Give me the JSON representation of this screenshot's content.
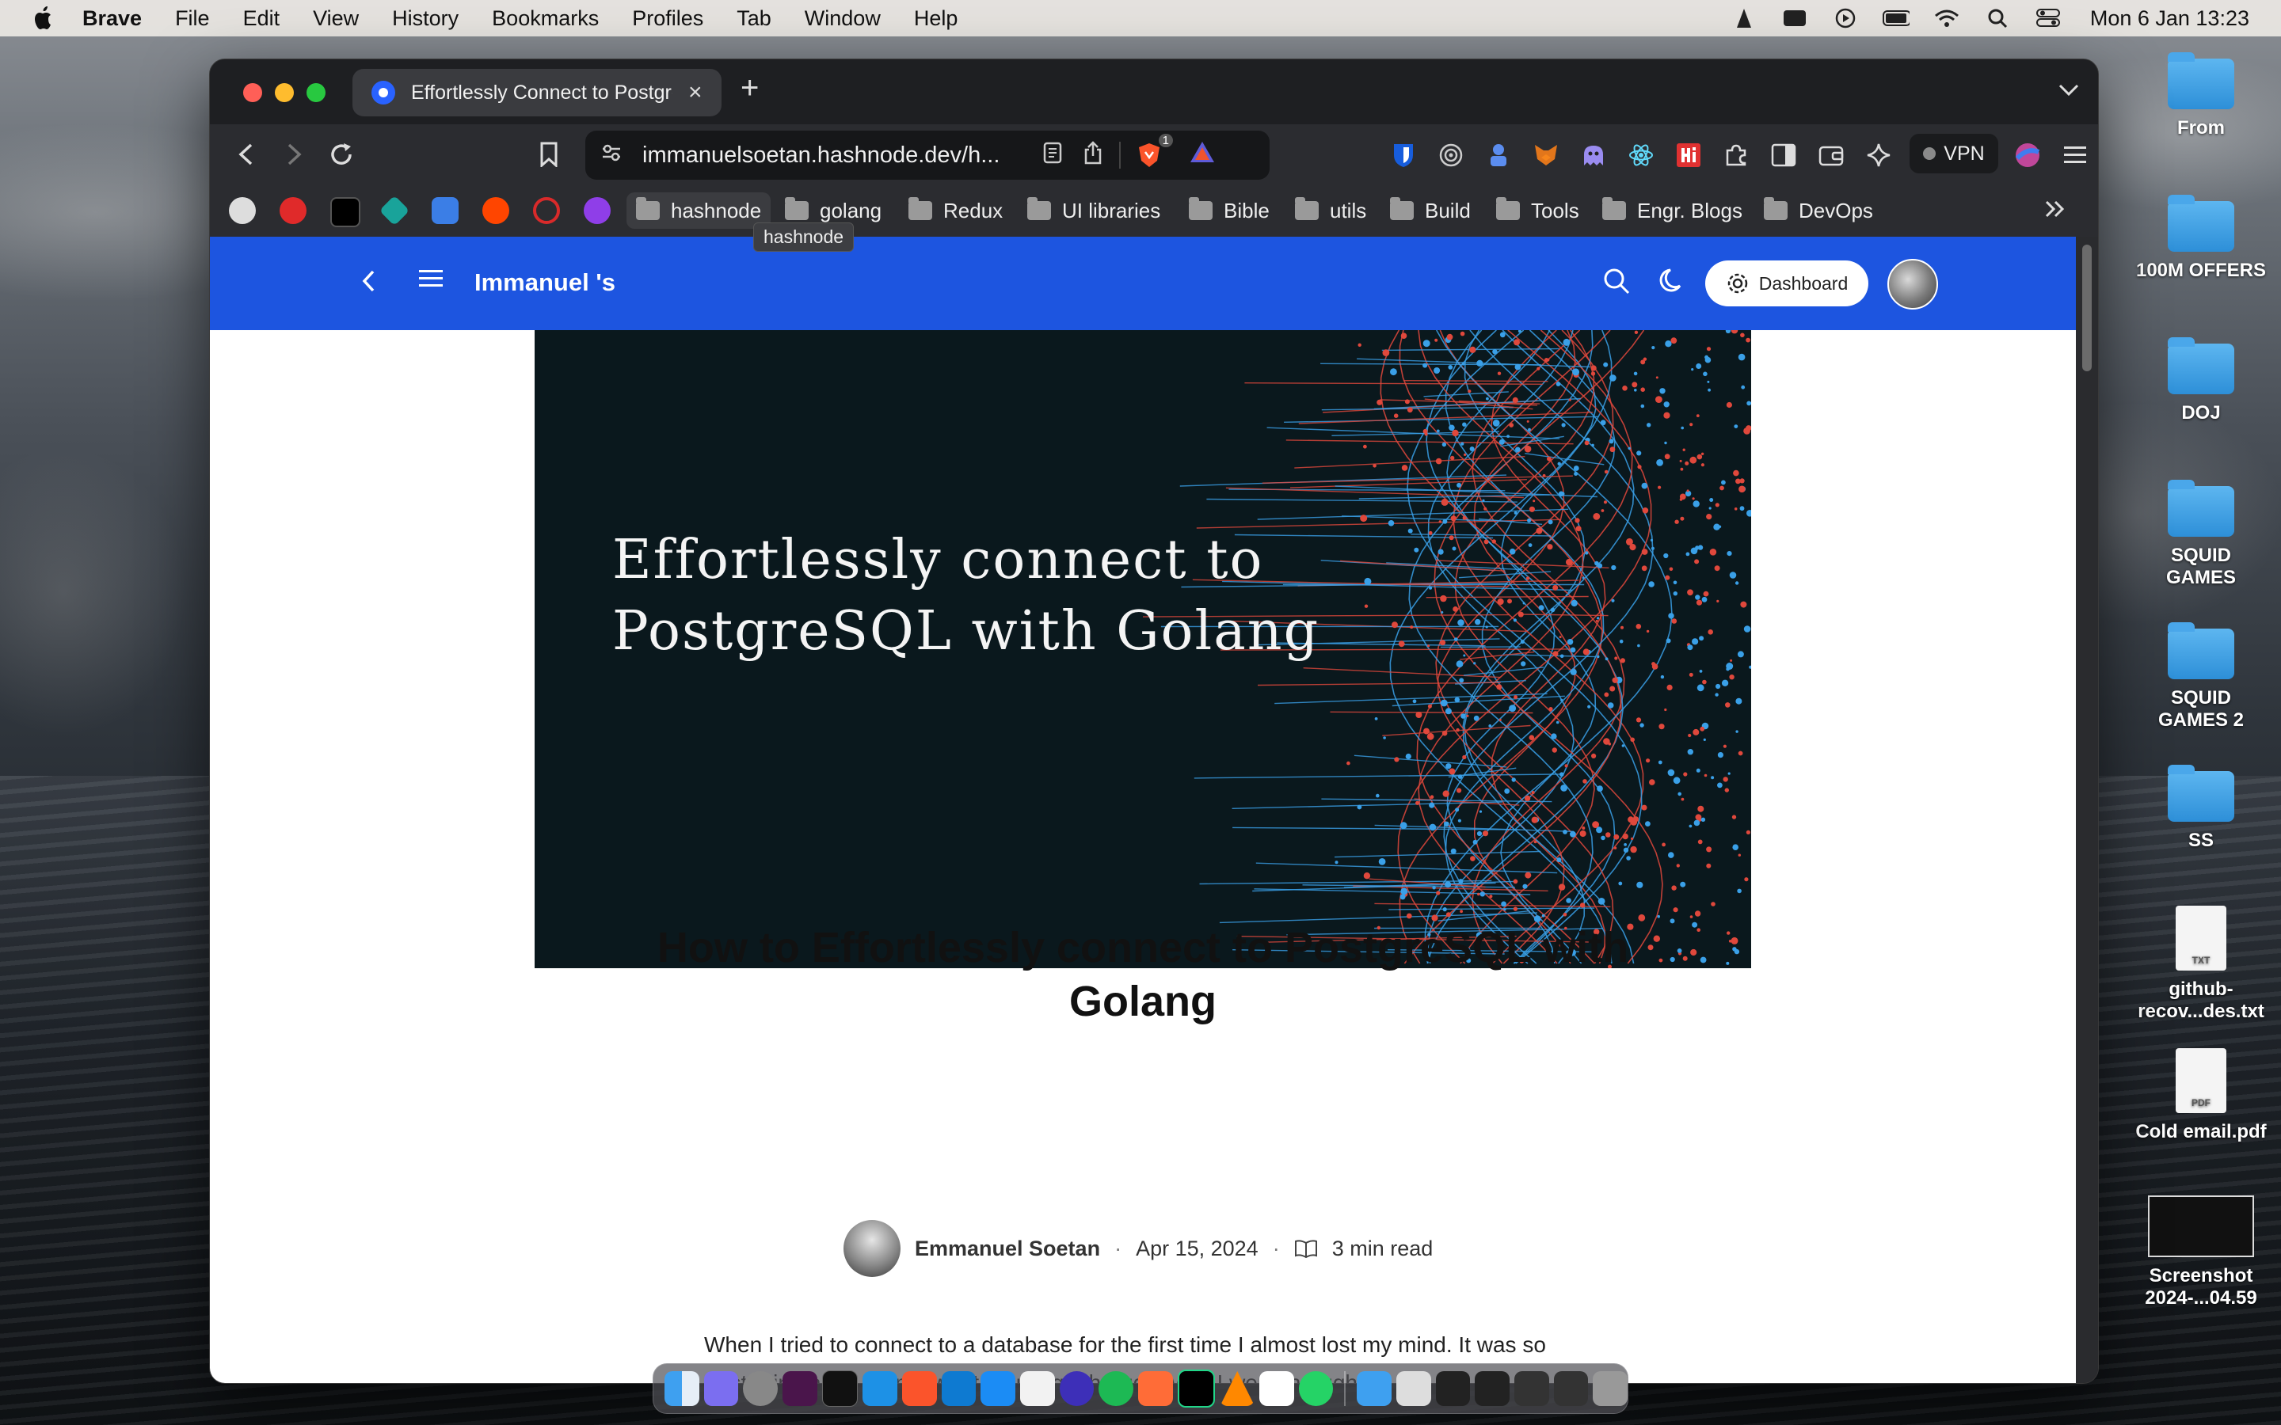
{
  "menubar": {
    "app": "Brave",
    "items": [
      "File",
      "Edit",
      "View",
      "History",
      "Bookmarks",
      "Profiles",
      "Tab",
      "Window",
      "Help"
    ],
    "clock": "Mon 6 Jan  13:23"
  },
  "browser": {
    "tab_title": "Effortlessly Connect to Postgres",
    "tab_close": "×",
    "new_tab": "+",
    "url": "immanuelsoetan.hashnode.dev/h...",
    "vpn_label": "VPN",
    "brave_badge": "1",
    "bookmark_folders": [
      "hashnode",
      "golang",
      "Redux",
      "UI libraries",
      "Bible",
      "utils",
      "Build",
      "Tools",
      "Engr. Blogs",
      "DevOps"
    ],
    "tooltip": "hashnode"
  },
  "site": {
    "blog_name": "Immanuel 's",
    "dashboard_label": "Dashboard"
  },
  "cover": {
    "title": "Effortlessly connect to\nPostgreSQL with Golang"
  },
  "post": {
    "title": "How to Effortlessly connect to PostgreSQL with Golang",
    "author": "Emmanuel Soetan",
    "date": "Apr 15, 2024",
    "read_time": "3 min read",
    "separator": "·",
    "intro": "When I tried to connect to a database for the first time I almost lost my mind. It was so frustrating and I do not want you to go through what I went through."
  },
  "desktop": {
    "items": [
      {
        "label": "From",
        "kind": "folder"
      },
      {
        "label": "100M OFFERS",
        "kind": "folder"
      },
      {
        "label": "DOJ",
        "kind": "folder"
      },
      {
        "label": "SQUID GAMES",
        "kind": "folder"
      },
      {
        "label": "SQUID GAMES 2",
        "kind": "folder"
      },
      {
        "label": "SS",
        "kind": "folder"
      },
      {
        "label": "github-recov...des.txt",
        "kind": "file",
        "ext": "TXT"
      },
      {
        "label": "Cold email.pdf",
        "kind": "file",
        "ext": "PDF"
      },
      {
        "label": "Screenshot 2024-...04.59",
        "kind": "screenshot"
      }
    ]
  },
  "colors": {
    "header_blue": "#1d55e0",
    "cover_bg": "#0a181d",
    "cover_red": "#e0483c",
    "cover_blue": "#3aa0e8"
  }
}
